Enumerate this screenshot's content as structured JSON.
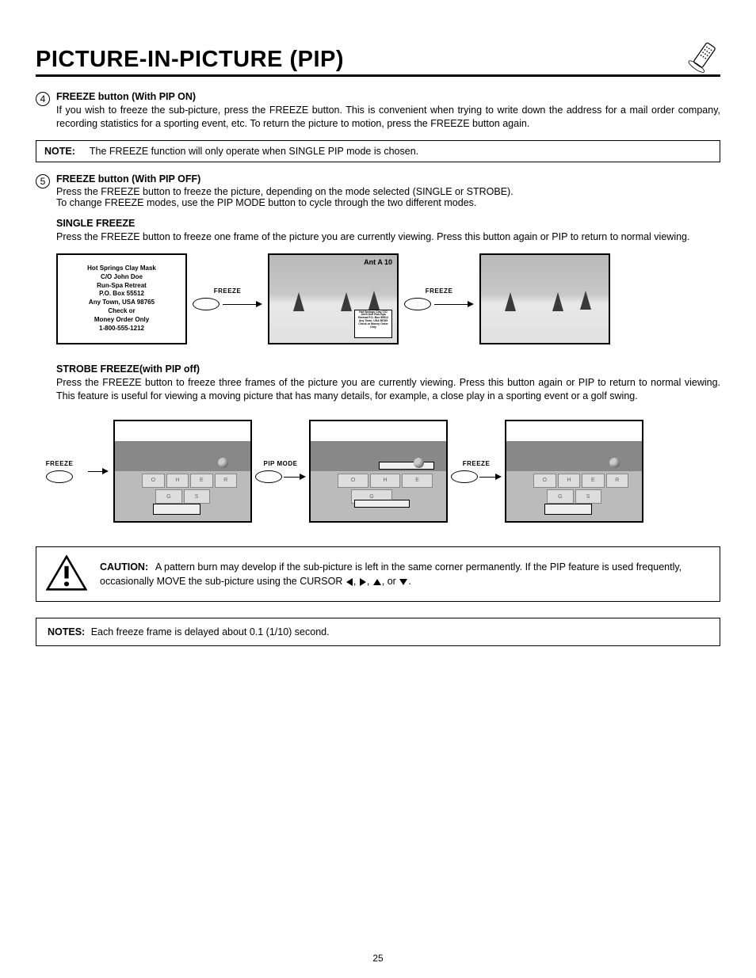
{
  "header": {
    "title": "PICTURE-IN-PICTURE (PIP)"
  },
  "step4": {
    "num": "4",
    "heading": "FREEZE button (With PIP ON)",
    "body": "If you wish to freeze the sub-picture, press the FREEZE button. This is convenient when trying to write down the address for a mail order company, recording statistics for a sporting event, etc.  To return the picture to motion, press the FREEZE button again."
  },
  "note1": {
    "label": "NOTE:",
    "text": "The FREEZE function will only operate when SINGLE PIP mode is chosen."
  },
  "step5": {
    "num": "5",
    "heading": "FREEZE button (With PIP OFF)",
    "line1": "Press the FREEZE button to freeze the picture, depending on the mode selected (SINGLE or STROBE).",
    "line2": "To change FREEZE modes, use the PIP MODE button to cycle through the two different modes."
  },
  "singleFreeze": {
    "heading": "SINGLE FREEZE",
    "body": "Press the FREEZE button to freeze one frame of the picture you are currently viewing.  Press this button again or PIP to return to normal viewing."
  },
  "mailCard": {
    "l1": "Hot Springs Clay Mask",
    "l2": "C/O John Doe",
    "l3": "Run-Spa Retreat",
    "l4": "P.O. Box 55512",
    "l5": "Any Town, USA 98765",
    "l6": "Check or",
    "l7": "Money Order Only",
    "l8": "1-800-555-1212"
  },
  "diagram1": {
    "freezeLabel": "FREEZE",
    "antLabel": "Ant A 10",
    "pipText": "Hot Springs Clay\nC/O John Doe\nRun-Spa Retreat\nP.O. Box 55512\nAny Town, USA 98765\nCheck or\nMoney Order Only"
  },
  "strobeFreeze": {
    "heading": "STROBE FREEZE(with PIP off)",
    "body": "Press the FREEZE button to freeze three frames of the picture you are currently viewing. Press this button again or PIP to return to normal viewing. This feature is useful for viewing a moving picture that has many details, for example, a close play in a sporting event or a golf swing."
  },
  "diagram2": {
    "freezeLabel": "FREEZE",
    "pipModeLabel": "PIP MODE"
  },
  "blockLetters": {
    "a": "O",
    "b": "H",
    "c": "E",
    "d": "R",
    "e": "G",
    "f": "S"
  },
  "caution": {
    "label": "CAUTION:",
    "textA": "A pattern burn may develop if the sub-picture is left in the same corner permanently.  If the PIP feature is used frequently, occasionally MOVE the sub-picture using the CURSOR ",
    "textB": ", ",
    "textC": ", ",
    "textD": ", or ",
    "textE": "."
  },
  "notes2": {
    "label": "NOTES:",
    "text": "Each freeze frame is delayed about 0.1 (1/10) second."
  },
  "pageNumber": "25"
}
